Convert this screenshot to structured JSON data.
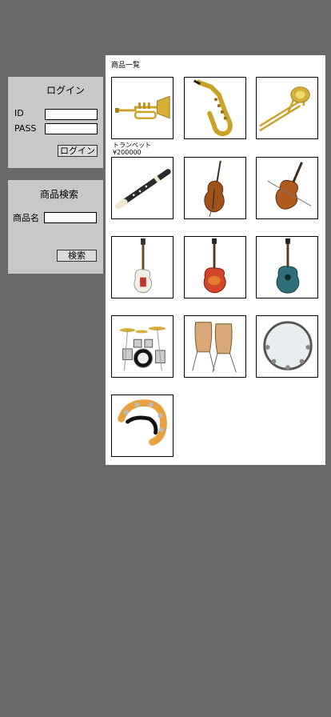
{
  "login": {
    "title": "ログイン",
    "id_label": "ID",
    "pass_label": "PASS",
    "button_label": "ログイン",
    "id_value": "",
    "pass_value": ""
  },
  "search": {
    "title": "商品検索",
    "name_label": "商品名",
    "name_value": "",
    "button_label": "検索"
  },
  "products": {
    "title": "商品一覧",
    "items": [
      {
        "icon": "trumpet-icon"
      },
      {
        "icon": "saxophone-icon"
      },
      {
        "icon": "trombone-icon"
      },
      {
        "icon": "recorder-icon"
      },
      {
        "icon": "contrabass-icon"
      },
      {
        "icon": "violin-icon"
      },
      {
        "icon": "electric-bass-icon"
      },
      {
        "icon": "electric-guitar-icon"
      },
      {
        "icon": "acoustic-guitar-icon"
      },
      {
        "icon": "drum-kit-icon"
      },
      {
        "icon": "conga-icon"
      },
      {
        "icon": "tambourine-icon"
      },
      {
        "icon": "half-moon-tambourine-icon"
      }
    ],
    "hover": {
      "name": "トランペット",
      "price": "¥200000"
    }
  }
}
